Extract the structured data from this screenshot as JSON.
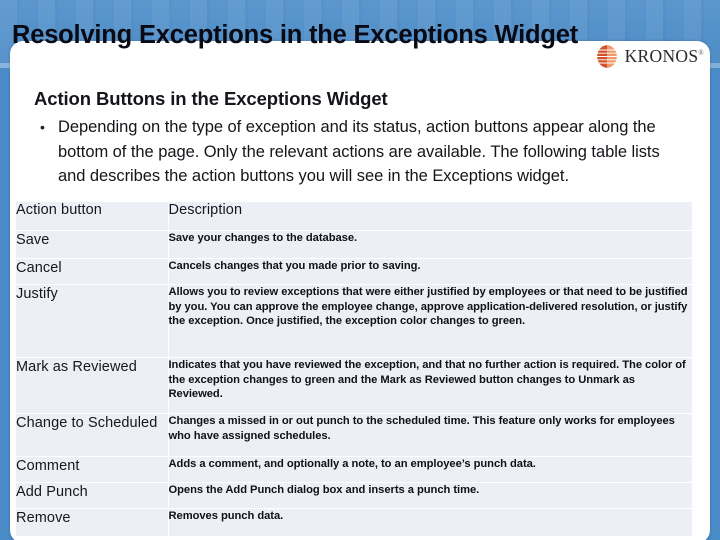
{
  "slide": {
    "title": "Resolving Exceptions in the Exceptions Widget",
    "frame_color": "#4a8cc7",
    "panel_color": "#ffffff"
  },
  "brand": {
    "name": "KRONOS",
    "trademark": "®",
    "mark_color_dark": "#d1512a",
    "mark_color_light": "#f0a070",
    "logo_icon": "kronos-flame-icon"
  },
  "body": {
    "heading": "Action Buttons in the Exceptions Widget",
    "bullet_marker": "•",
    "bullet_text": "Depending on the type of exception and its status, action buttons appear along the bottom of the page. Only the relevant actions are available. The following table lists and describes the action buttons you will see in the Exceptions widget."
  },
  "table": {
    "headers": [
      "Action button",
      "Description"
    ],
    "rows": [
      {
        "action": "Save",
        "description": "Save your changes to the database."
      },
      {
        "action": "Cancel",
        "description": "Cancels changes that you made prior to saving."
      },
      {
        "action": "Justify",
        "description": "Allows you to review exceptions that were either justified by employees or that need to be justified by you. You can approve the employee change, approve application-delivered resolution, or justify the exception. Once justified, the exception color changes to green."
      },
      {
        "action": "Mark as Reviewed",
        "description": "Indicates that you have reviewed the exception, and that no further action is required. The color of the exception changes to green and the Mark as Reviewed button changes to Unmark as Reviewed."
      },
      {
        "action": "Change to Scheduled",
        "description": "Changes a missed in or out punch to the scheduled time. This feature only works for employees who have assigned schedules."
      },
      {
        "action": "Comment",
        "description": "Adds a comment, and optionally a note, to an employee’s punch data."
      },
      {
        "action": "Add Punch",
        "description": "Opens the Add Punch dialog box and inserts a punch time."
      },
      {
        "action": "Remove",
        "description": "Removes punch data."
      }
    ]
  }
}
